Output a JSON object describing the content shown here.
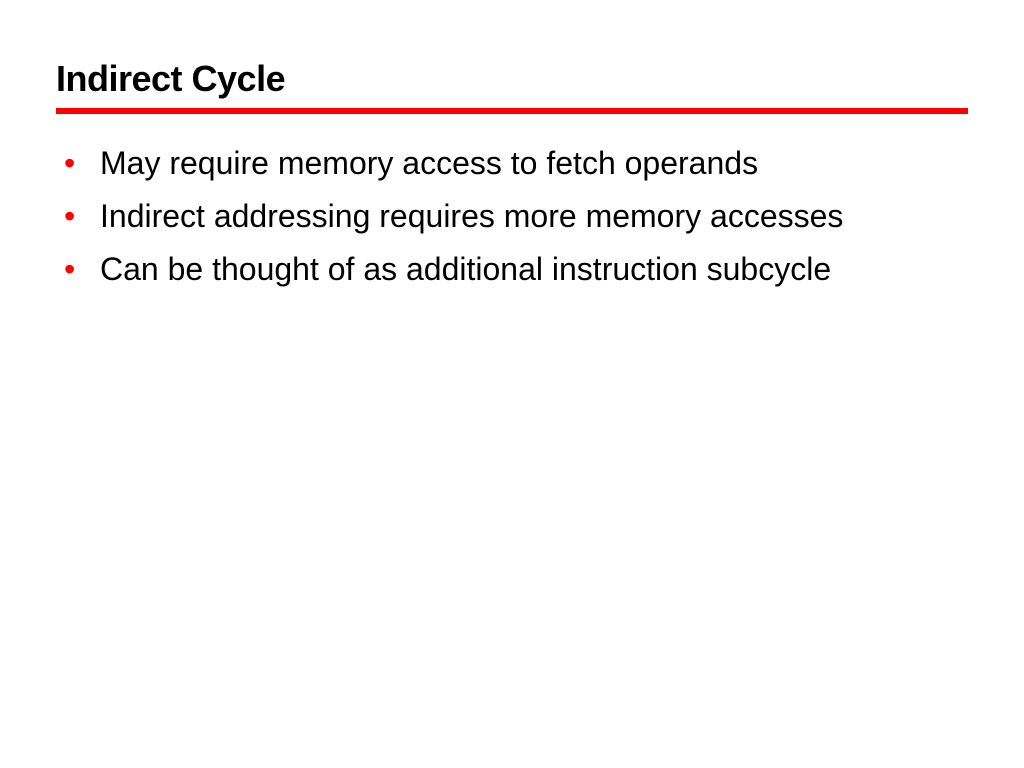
{
  "slide": {
    "title": "Indirect Cycle",
    "bullets": [
      "May require memory access to fetch operands",
      "Indirect addressing requires more memory accesses",
      "Can be thought of as additional instruction subcycle"
    ]
  }
}
